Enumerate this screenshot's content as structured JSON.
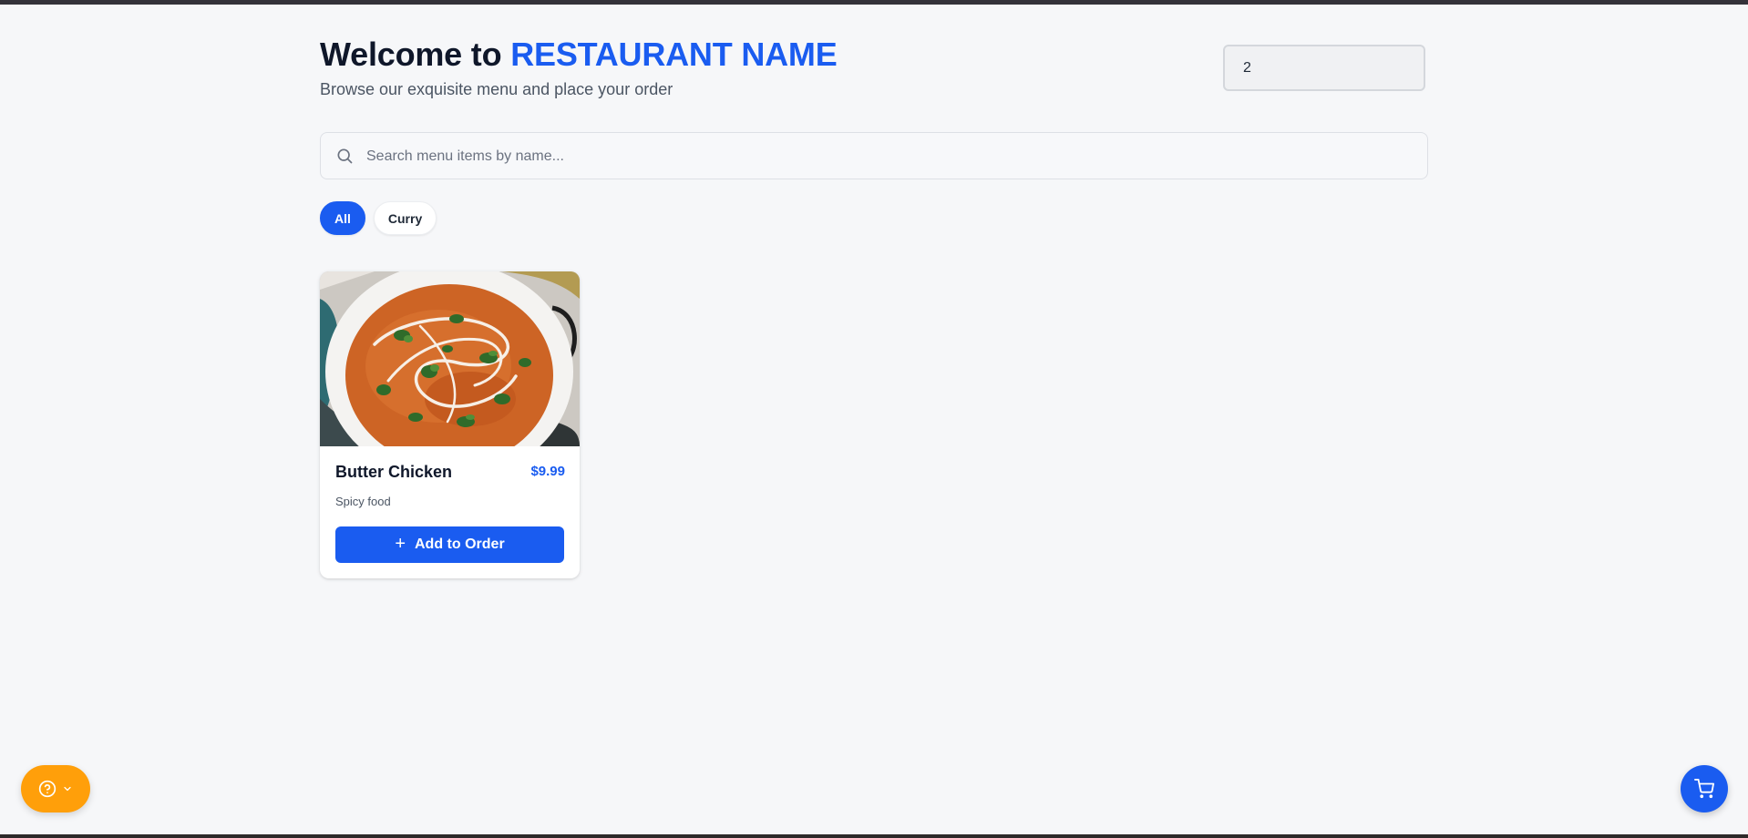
{
  "header": {
    "title_prefix": "Welcome to",
    "title_accent": "RESTAURANT NAME",
    "subtitle": "Browse our exquisite menu and place your order"
  },
  "table_input": {
    "value": "2"
  },
  "search": {
    "placeholder": "Search menu items by name...",
    "icon": "search-icon"
  },
  "filters": [
    {
      "label": "All",
      "active": true
    },
    {
      "label": "Curry",
      "active": false
    }
  ],
  "menu_items": [
    {
      "name": "Butter Chicken",
      "price": "$9.99",
      "description": "Spicy food",
      "button_label": "Add to Order",
      "button_icon": "plus-icon"
    }
  ],
  "floating": {
    "help_icons": [
      "help-circle-icon",
      "chevron-down-icon"
    ],
    "cart_icon": "cart-icon"
  },
  "colors": {
    "accent": "#1a5cf0",
    "help_button": "#ff9f0a",
    "background": "#f6f7f9"
  }
}
